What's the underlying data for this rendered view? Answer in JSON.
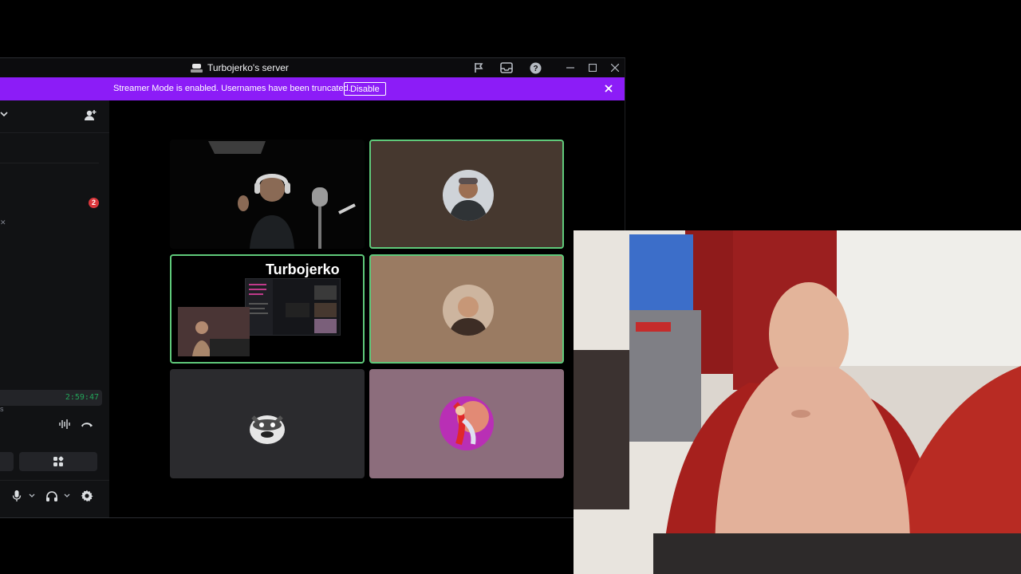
{
  "window": {
    "title": "Turbojerko's server"
  },
  "banner": {
    "text": "Streamer Mode is enabled. Usernames have been truncated.",
    "button_label": "Disable"
  },
  "sidebar": {
    "mention_count": "2",
    "call_timer": "2:59:47"
  },
  "tiles": {
    "stream_overlay_name": "Turbojerko"
  },
  "colors": {
    "banner": "#8c1cf7",
    "speaking_ring": "#5fc97a",
    "timer": "#23a55a",
    "badge": "#da373c"
  }
}
